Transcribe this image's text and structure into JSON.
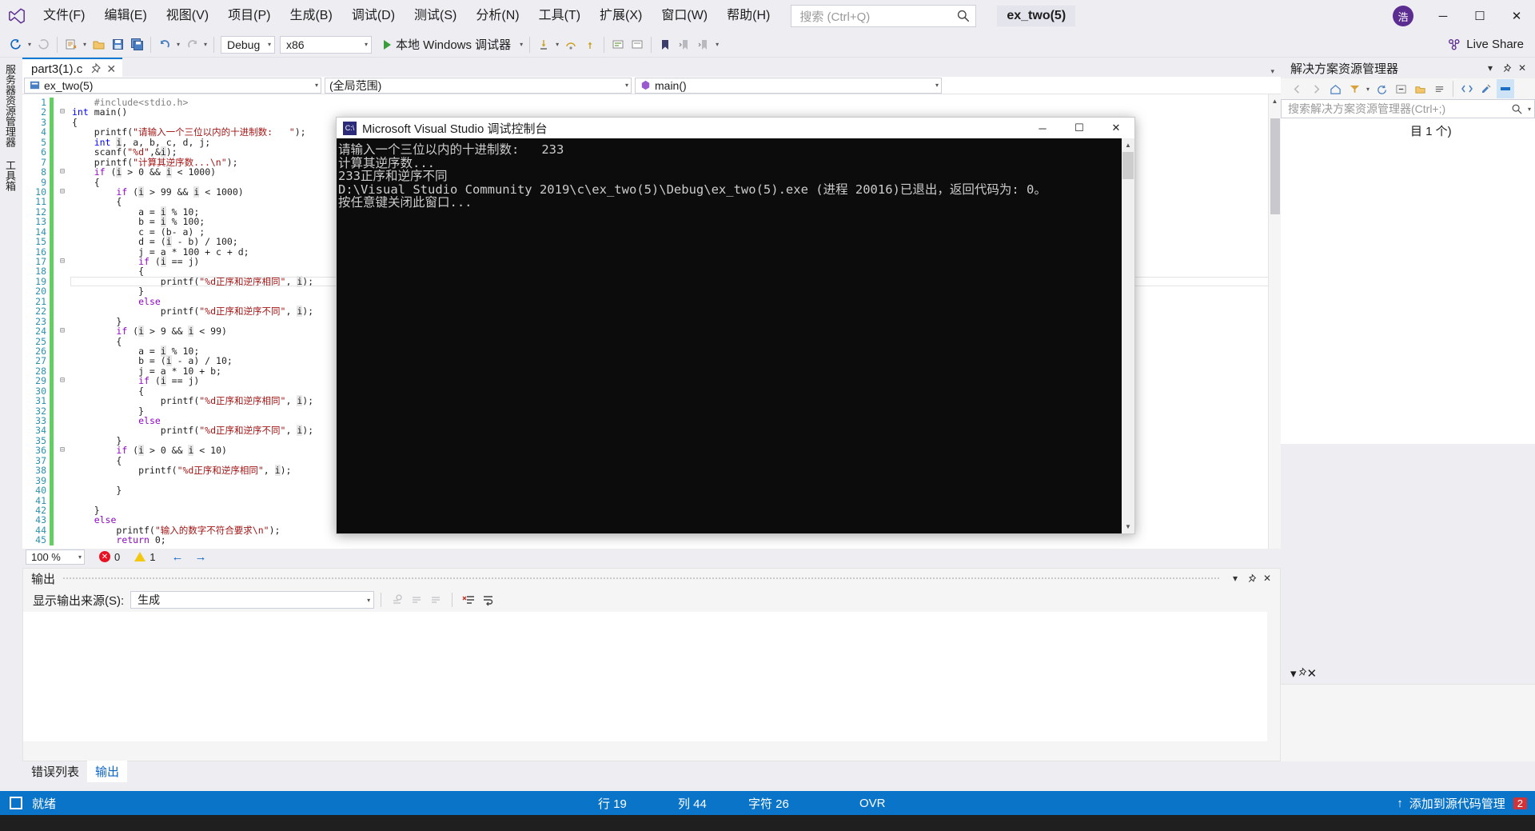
{
  "app": {
    "logo": "visual-studio-logo",
    "solution_name": "ex_two(5)",
    "account_initial": "浩"
  },
  "menu": {
    "items": [
      {
        "label": "文件(F)"
      },
      {
        "label": "编辑(E)"
      },
      {
        "label": "视图(V)"
      },
      {
        "label": "项目(P)"
      },
      {
        "label": "生成(B)"
      },
      {
        "label": "调试(D)"
      },
      {
        "label": "测试(S)"
      },
      {
        "label": "分析(N)"
      },
      {
        "label": "工具(T)"
      },
      {
        "label": "扩展(X)"
      },
      {
        "label": "窗口(W)"
      },
      {
        "label": "帮助(H)"
      }
    ]
  },
  "quick_search": {
    "placeholder": "搜索 (Ctrl+Q)"
  },
  "window_buttons": {
    "minimize": "─",
    "maximize": "☐",
    "close": "✕"
  },
  "toolbar": {
    "config": "Debug",
    "platform": "x86",
    "run_label": "本地 Windows 调试器",
    "live_share": "Live Share"
  },
  "left_rail": {
    "tabs": [
      "服务器资源管理器",
      "工具箱"
    ]
  },
  "document_tab": {
    "title": "part3(1).c",
    "close": "✕"
  },
  "nav_bar": {
    "project": "ex_two(5)",
    "scope": "(全局范围)",
    "member": "main()"
  },
  "editor": {
    "zoom": "100 %",
    "error_count": "0",
    "warning_count": "1",
    "lines": [
      {
        "n": "1",
        "fold": "",
        "text": "    #include<stdio.h>"
      },
      {
        "n": "2",
        "fold": "-",
        "text": "int main()"
      },
      {
        "n": "3",
        "fold": "",
        "text": "{"
      },
      {
        "n": "4",
        "fold": "",
        "text": "    printf(\"请输入一个三位以内的十进制数:   \");"
      },
      {
        "n": "5",
        "fold": "",
        "text": "    int i, a, b, c, d, j;"
      },
      {
        "n": "6",
        "fold": "",
        "text": "    scanf(\"%d\",&i);"
      },
      {
        "n": "7",
        "fold": "",
        "text": "    printf(\"计算其逆序数...\\n\");"
      },
      {
        "n": "8",
        "fold": "-",
        "text": "    if (i > 0 && i < 1000)"
      },
      {
        "n": "9",
        "fold": "",
        "text": "    {"
      },
      {
        "n": "10",
        "fold": "-",
        "text": "        if (i > 99 && i < 1000)"
      },
      {
        "n": "11",
        "fold": "",
        "text": "        {"
      },
      {
        "n": "12",
        "fold": "",
        "text": "            a = i % 10;"
      },
      {
        "n": "13",
        "fold": "",
        "text": "            b = i % 100;"
      },
      {
        "n": "14",
        "fold": "",
        "text": "            c = (b- a) ;"
      },
      {
        "n": "15",
        "fold": "",
        "text": "            d = (i - b) / 100;"
      },
      {
        "n": "16",
        "fold": "",
        "text": "            j = a * 100 + c + d;"
      },
      {
        "n": "17",
        "fold": "-",
        "text": "            if (i == j)"
      },
      {
        "n": "18",
        "fold": "",
        "text": "            {"
      },
      {
        "n": "19",
        "fold": "",
        "text": "                printf(\"%d正序和逆序相同\", i);"
      },
      {
        "n": "20",
        "fold": "",
        "text": "            }"
      },
      {
        "n": "21",
        "fold": "",
        "text": "            else"
      },
      {
        "n": "22",
        "fold": "",
        "text": "                printf(\"%d正序和逆序不同\", i);"
      },
      {
        "n": "23",
        "fold": "",
        "text": "        }"
      },
      {
        "n": "24",
        "fold": "-",
        "text": "        if (i > 9 && i < 99)"
      },
      {
        "n": "25",
        "fold": "",
        "text": "        {"
      },
      {
        "n": "26",
        "fold": "",
        "text": "            a = i % 10;"
      },
      {
        "n": "27",
        "fold": "",
        "text": "            b = (i - a) / 10;"
      },
      {
        "n": "28",
        "fold": "",
        "text": "            j = a * 10 + b;"
      },
      {
        "n": "29",
        "fold": "-",
        "text": "            if (i == j)"
      },
      {
        "n": "30",
        "fold": "",
        "text": "            {"
      },
      {
        "n": "31",
        "fold": "",
        "text": "                printf(\"%d正序和逆序相同\", i);"
      },
      {
        "n": "32",
        "fold": "",
        "text": "            }"
      },
      {
        "n": "33",
        "fold": "",
        "text": "            else"
      },
      {
        "n": "34",
        "fold": "",
        "text": "                printf(\"%d正序和逆序不同\", i);"
      },
      {
        "n": "35",
        "fold": "",
        "text": "        }"
      },
      {
        "n": "36",
        "fold": "-",
        "text": "        if (i > 0 && i < 10)"
      },
      {
        "n": "37",
        "fold": "",
        "text": "        {"
      },
      {
        "n": "38",
        "fold": "",
        "text": "            printf(\"%d正序和逆序相同\", i);"
      },
      {
        "n": "39",
        "fold": "",
        "text": ""
      },
      {
        "n": "40",
        "fold": "",
        "text": "        }"
      },
      {
        "n": "41",
        "fold": "",
        "text": ""
      },
      {
        "n": "42",
        "fold": "",
        "text": "    }"
      },
      {
        "n": "43",
        "fold": "",
        "text": "    else"
      },
      {
        "n": "44",
        "fold": "",
        "text": "        printf(\"输入的数字不符合要求\\n\");"
      },
      {
        "n": "45",
        "fold": "",
        "text": "        return 0;"
      }
    ],
    "current_line": "19"
  },
  "output_pane": {
    "title": "输出",
    "source_label": "显示输出来源(S):",
    "source_value": "生成",
    "tabs": [
      {
        "label": "错误列表",
        "active": false
      },
      {
        "label": "输出",
        "active": true
      }
    ]
  },
  "solution_explorer": {
    "title": "解决方案资源管理器",
    "search_placeholder": "搜索解决方案资源管理器(Ctrl+;)",
    "tree_hint": "目 1 个)"
  },
  "properties_pane": {
    "title": ""
  },
  "console": {
    "title": "Microsoft Visual Studio 调试控制台",
    "icon_label": "C:\\",
    "lines": [
      "请输入一个三位以内的十进制数:   233",
      "计算其逆序数...",
      "233正序和逆序不同",
      "D:\\Visual Studio Community 2019\\c\\ex_two(5)\\Debug\\ex_two(5).exe (进程 20016)已退出，返回代码为: 0。",
      "按任意键关闭此窗口..."
    ],
    "buttons": {
      "minimize": "─",
      "maximize": "☐",
      "close": "✕"
    }
  },
  "status_bar": {
    "ready": "就绪",
    "line_label": "行 19",
    "col_label": "列 44",
    "char_label": "字符 26",
    "mode": "OVR",
    "source_control": "添加到源代码管理",
    "notification_count": "2",
    "accent": "#0a74c8"
  }
}
